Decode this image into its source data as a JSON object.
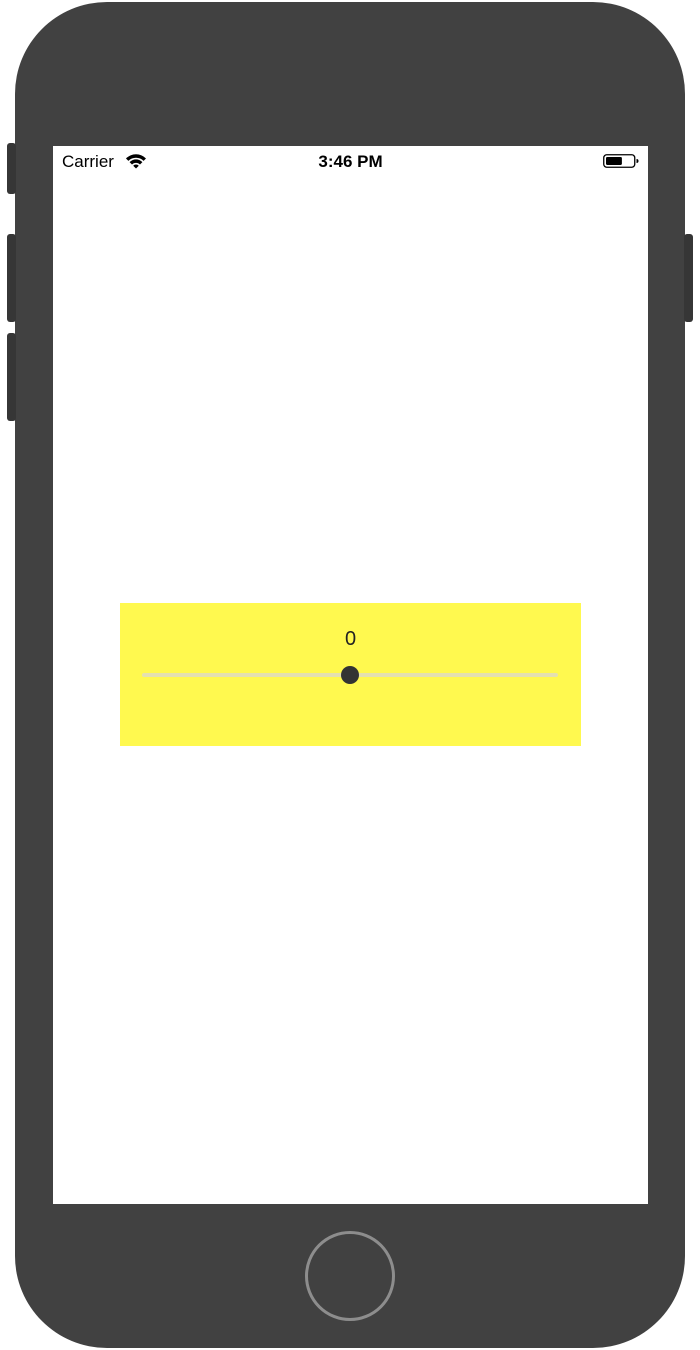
{
  "status_bar": {
    "carrier": "Carrier",
    "time": "3:46 PM",
    "wifi_icon": "wifi-icon",
    "battery_icon": "battery-icon",
    "battery_level": 0.6
  },
  "slider_panel": {
    "value_label": "0",
    "slider": {
      "min": -1,
      "max": 1,
      "value": 0
    },
    "colors": {
      "background": "#fff94f",
      "thumb": "#333333"
    }
  },
  "device": {
    "home_button_icon": "home-button"
  }
}
